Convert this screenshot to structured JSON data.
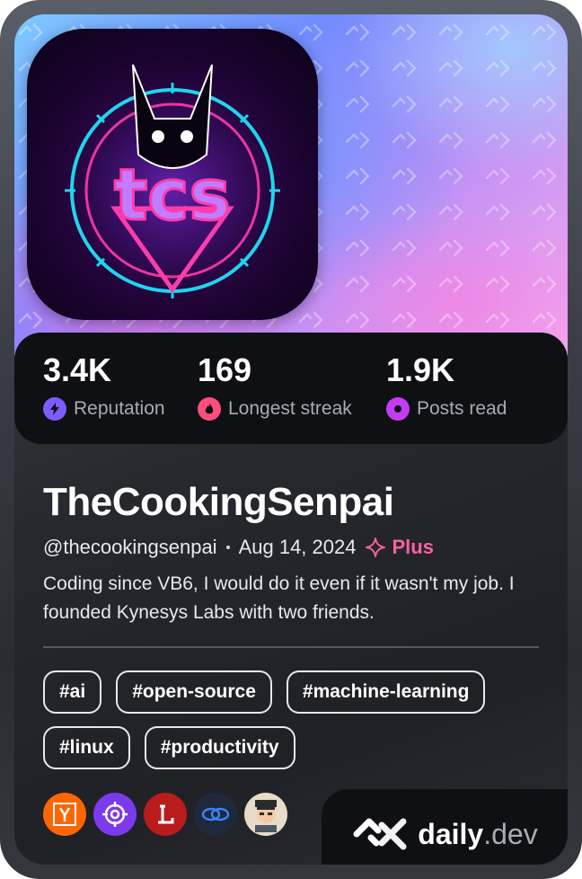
{
  "avatar": {
    "text": "tcs"
  },
  "stats": [
    {
      "value": "3.4K",
      "label": "Reputation",
      "icon": "lightning-icon",
      "color": "#7b5cff"
    },
    {
      "value": "169",
      "label": "Longest streak",
      "icon": "flame-icon",
      "color": "#ff4d7d"
    },
    {
      "value": "1.9K",
      "label": "Posts read",
      "icon": "eye-icon",
      "color": "#c43cf0"
    }
  ],
  "profile": {
    "name": "TheCookingSenpai",
    "handle": "@thecookingsenpai",
    "joined": "Aug 14, 2024",
    "plus_label": "Plus",
    "bio": "Coding since VB6, I would do it even if it wasn't my job. I founded Kynesys Labs with two friends."
  },
  "tags": [
    "#ai",
    "#open-source",
    "#machine-learning",
    "#linux",
    "#productivity"
  ],
  "sources": [
    {
      "name": "hacker-news-icon",
      "letter": "Y",
      "color": "#ff6600"
    },
    {
      "name": "target-icon",
      "letter": "",
      "color": "#7c3aed"
    },
    {
      "name": "letter-l-icon",
      "letter": "L",
      "color": "#b91c1c"
    },
    {
      "name": "links-icon",
      "letter": "",
      "color": "#1e3a8a"
    },
    {
      "name": "user-avatar-icon",
      "letter": "",
      "color": "#e7dcc8"
    }
  ],
  "brand": {
    "name": "daily",
    "suffix": ".dev"
  },
  "colors": {
    "accent_plus": "#ff5fa2",
    "stats_bg": "#0f1013"
  }
}
